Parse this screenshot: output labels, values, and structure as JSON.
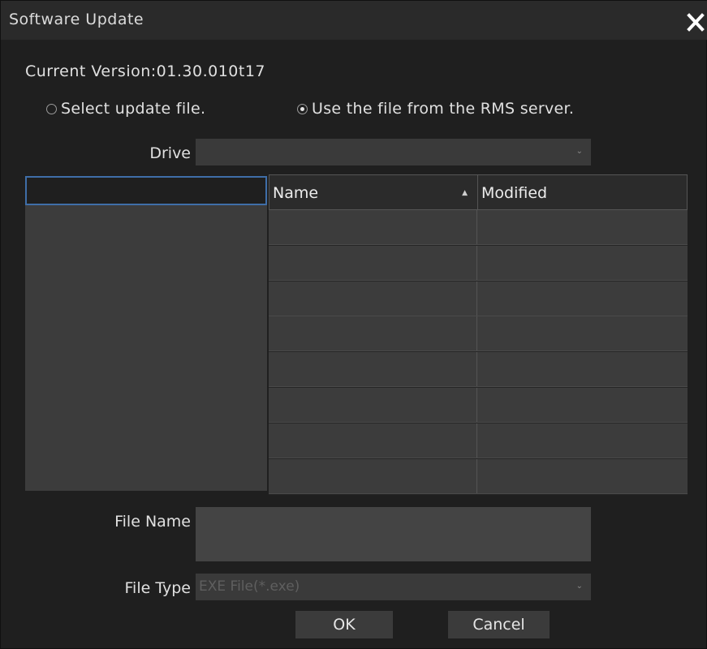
{
  "dialog": {
    "title": "Software Update"
  },
  "version": {
    "text": "Current Version:01.30.010t17"
  },
  "source_options": [
    {
      "label": "Select update file.",
      "selected": false
    },
    {
      "label": "Use the file from the RMS server.",
      "selected": true
    }
  ],
  "drive": {
    "label": "Drive",
    "value": ""
  },
  "file_list": {
    "columns": [
      {
        "label": "Name",
        "sort": "ascending"
      },
      {
        "label": "Modified"
      }
    ],
    "rows": [
      {
        "name": "",
        "modified": ""
      },
      {
        "name": "",
        "modified": ""
      },
      {
        "name": "",
        "modified": ""
      },
      {
        "name": "",
        "modified": ""
      },
      {
        "name": "",
        "modified": ""
      },
      {
        "name": "",
        "modified": ""
      },
      {
        "name": "",
        "modified": ""
      },
      {
        "name": "",
        "modified": ""
      }
    ]
  },
  "file_name": {
    "label": "File Name",
    "value": ""
  },
  "file_type": {
    "label": "File Type",
    "value": "EXE File(*.exe)"
  },
  "buttons": {
    "ok": "OK",
    "cancel": "Cancel"
  },
  "icons": {
    "close": "close-icon",
    "dropdown": "chevron-down-icon",
    "sort": "sort-ascending-icon"
  }
}
